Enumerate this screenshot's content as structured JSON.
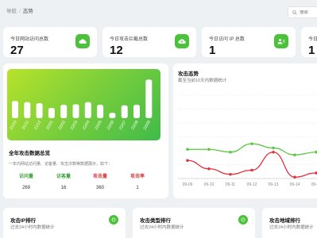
{
  "breadcrumb": {
    "root": "导航",
    "separator": "/",
    "current": "态势"
  },
  "search": {
    "placeholder": "搜索"
  },
  "stats": [
    {
      "label": "今日网站访问总数",
      "value": "27",
      "icon": "cloud-icon"
    },
    {
      "label": "今日攻击拦截总数",
      "value": "12",
      "icon": "cloud-upload-icon"
    },
    {
      "label": "今日访问 IP 总数",
      "value": "1",
      "icon": "users-icon"
    },
    {
      "label": "今日",
      "value": "1",
      "icon": ""
    }
  ],
  "colors": {
    "accent": "#4cc23b",
    "line_green": "#5ac83e",
    "line_red": "#e0333e",
    "metric_green": "#3aa33a",
    "metric_red": "#d23b3b"
  },
  "summary": {
    "title": "全年攻击数据总览",
    "subtitle": "一年内网站访问量、访客量、攻击次数等数据展示，如下：",
    "metrics": [
      {
        "label": "访问量",
        "value": "269",
        "color": "#3aa33a"
      },
      {
        "label": "访客量",
        "value": "16",
        "color": "#3aa33a"
      },
      {
        "label": "攻击量",
        "value": "360",
        "color": "#d23b3b"
      },
      {
        "label": "攻击率",
        "value": "1",
        "color": "#d23b3b"
      }
    ]
  },
  "trend": {
    "title": "攻击态势",
    "subtitle": "截至当前10天内数据统计"
  },
  "ranks": [
    {
      "title": "攻击IP排行",
      "subtitle": "过去24小时内数据统计"
    },
    {
      "title": "攻击类型排行",
      "subtitle": "过去24小时内数据统计"
    },
    {
      "title": "攻击地域排行",
      "subtitle": "过去24小时内数据统计"
    }
  ],
  "chart_data": [
    {
      "type": "bar",
      "categories": [
        "21/10",
        "21/11",
        "21/12",
        "22/01",
        "22/02",
        "22/03",
        "22/04",
        "22/05",
        "22/06",
        "22/07",
        "22/08",
        "22/09"
      ],
      "values": [
        32,
        30,
        28,
        19,
        25,
        26,
        30,
        25,
        10,
        24,
        25,
        72
      ],
      "ylim": [
        0,
        80
      ]
    },
    {
      "type": "line",
      "categories": [
        "09-09",
        "09-10",
        "09-11",
        "09-12",
        "09-13",
        "09-14",
        "09-15"
      ],
      "y_ticks": [
        0,
        10,
        20,
        30,
        40,
        50,
        60
      ],
      "ylim": [
        0,
        60
      ],
      "series": [
        {
          "values": [
            21,
            21,
            19,
            25,
            22,
            17,
            19
          ],
          "color": "#5ac83e"
        },
        {
          "values": [
            13,
            7,
            3,
            6,
            19,
            1,
            4
          ],
          "color": "#e0333e"
        }
      ]
    }
  ]
}
